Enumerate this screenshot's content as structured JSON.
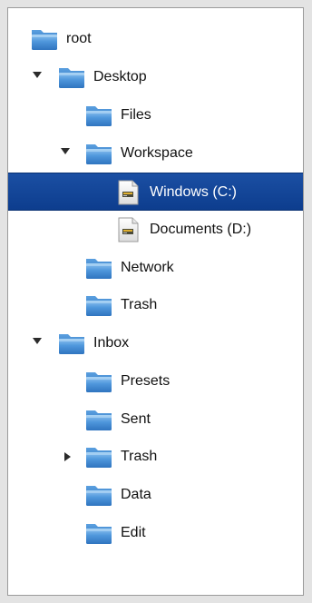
{
  "tree": {
    "items": [
      {
        "label": "root",
        "icon": "folder-icon",
        "expanded": null
      },
      {
        "label": "Desktop",
        "icon": "folder-icon",
        "expanded": true
      },
      {
        "label": "Files",
        "icon": "folder-icon",
        "expanded": null
      },
      {
        "label": "Workspace",
        "icon": "folder-icon",
        "expanded": true
      },
      {
        "label": "Windows (C:)",
        "icon": "drive-icon",
        "expanded": null,
        "selected": true
      },
      {
        "label": "Documents (D:)",
        "icon": "drive-icon",
        "expanded": null
      },
      {
        "label": "Network",
        "icon": "folder-icon",
        "expanded": null
      },
      {
        "label": "Trash",
        "icon": "folder-icon",
        "expanded": null
      },
      {
        "label": "Inbox",
        "icon": "folder-icon",
        "expanded": true
      },
      {
        "label": "Presets",
        "icon": "folder-icon",
        "expanded": null
      },
      {
        "label": "Sent",
        "icon": "folder-icon",
        "expanded": null
      },
      {
        "label": "Trash",
        "icon": "folder-icon",
        "expanded": false
      },
      {
        "label": "Data",
        "icon": "folder-icon",
        "expanded": null
      },
      {
        "label": "Edit",
        "icon": "folder-icon",
        "expanded": null
      }
    ]
  },
  "colors": {
    "selection": "#1b4fa3",
    "folder": "#4a90d9"
  }
}
